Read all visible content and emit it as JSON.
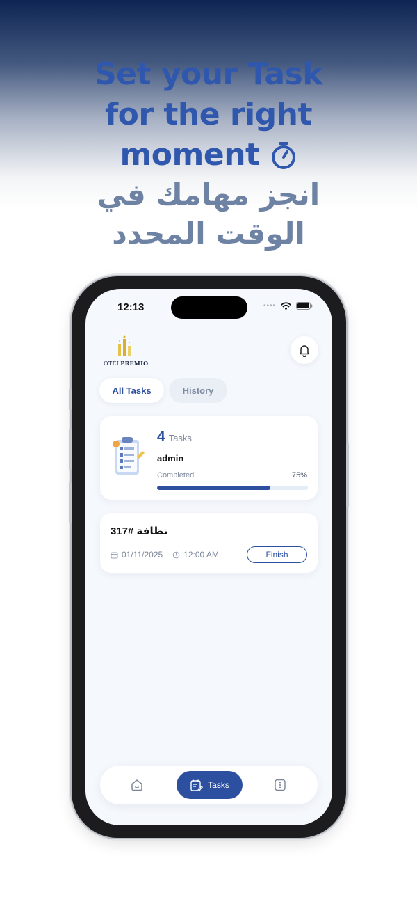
{
  "headline": {
    "en_line1": "Set your Task",
    "en_line2": "for the right",
    "en_line3": "moment",
    "ar_line1": "انجز مهامك في",
    "ar_line2": "الوقت المحدد"
  },
  "status_bar": {
    "time": "12:13",
    "dots": "••••"
  },
  "app": {
    "logo_text_a": "OTEL",
    "logo_text_b": "PREMIO",
    "tabs": {
      "all": "All Tasks",
      "history": "History"
    }
  },
  "summary": {
    "count": "4",
    "count_label": "Tasks",
    "user": "admin",
    "completed_label": "Completed",
    "percent_text": "75%",
    "progress": 0.75
  },
  "task": {
    "title": "نظافة #317",
    "date": "01/11/2025",
    "time": "12:00 AM",
    "finish_label": "Finish"
  },
  "bottom_nav": {
    "tasks_label": "Tasks"
  },
  "colors": {
    "accent": "#2d4f9f",
    "headline_en": "#2f57ad",
    "headline_ar": "#6e83a4"
  }
}
